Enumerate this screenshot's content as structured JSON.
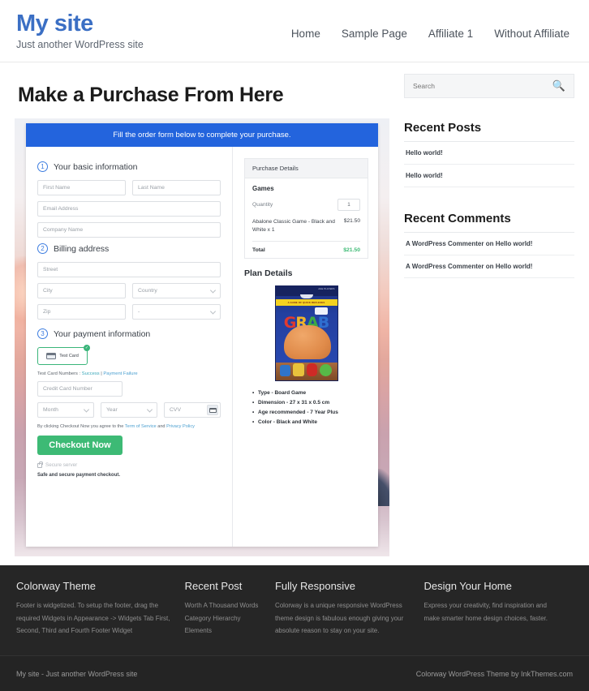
{
  "header": {
    "site_title": "My site",
    "tagline": "Just another WordPress site",
    "nav": [
      {
        "label": "Home"
      },
      {
        "label": "Sample Page"
      },
      {
        "label": "Affiliate 1"
      },
      {
        "label": "Without Affiliate"
      }
    ]
  },
  "main": {
    "page_title": "Make a Purchase From Here",
    "order_form": {
      "banner": "Fill the order form below to complete your purchase.",
      "steps": [
        {
          "number": "1",
          "label": "Your basic information"
        },
        {
          "number": "2",
          "label": "Billing address"
        },
        {
          "number": "3",
          "label": "Your payment information"
        }
      ],
      "fields": {
        "first_name": "First Name",
        "last_name": "Last Name",
        "email": "Email Address",
        "company": "Company Name",
        "street": "Street",
        "city": "City",
        "country": "Country",
        "zip": "Zip",
        "state": "-",
        "credit_card_number": "Credit Card Number",
        "month": "Month",
        "year": "Year",
        "cvv": "CVV"
      },
      "card_option": {
        "label": "Test Card",
        "selected_mark": "✓"
      },
      "test_numbers": {
        "prefix": "Test Card Numbers : ",
        "success": "Success",
        "separator": " | ",
        "failure": "Payment Failure"
      },
      "terms": {
        "prefix": "By clicking Checkout Now you agree to the ",
        "tos": "Term of Service",
        "mid": " and ",
        "privacy": "Privacy Policy"
      },
      "checkout_label": "Checkout Now",
      "secure_server": "Secure server",
      "safe_text": "Safe and secure payment checkout."
    },
    "purchase_details": {
      "heading": "Purchase Details",
      "group": "Games",
      "quantity_label": "Quantity",
      "quantity_value": "1",
      "item_name": "Abalone Classic Game - Black and White x 1",
      "item_price": "$21.50",
      "total_label": "Total",
      "total_value": "$21.50",
      "total_color": "#3dba75"
    },
    "plan_details": {
      "heading": "Plan Details",
      "product_art": {
        "title": "GRAB",
        "banner": "A GAME OF QUICK REFLEXES",
        "corner": "AGE  PLAYERS"
      },
      "specs": [
        "Type - Board Game",
        "Dimension - 27 x 31 x 0.5 cm",
        "Age recommended - 7 Year Plus",
        "Color - Black and White"
      ]
    }
  },
  "sidebar": {
    "search_placeholder": "Search",
    "widgets": [
      {
        "title": "Recent Posts",
        "items": [
          "Hello world!",
          "Hello world!"
        ]
      },
      {
        "title": "Recent Comments",
        "items": [
          "A WordPress Commenter on Hello world!",
          "A WordPress Commenter on Hello world!"
        ]
      }
    ]
  },
  "footer": {
    "columns": [
      {
        "title": "Colorway Theme",
        "text": "Footer is widgetized. To setup the footer, drag the required Widgets in Appearance -> Widgets Tab First, Second, Third and Fourth Footer Widget"
      },
      {
        "title": "Recent Post",
        "items": [
          "Worth A Thousand Words",
          "Category Hierarchy",
          "Elements"
        ]
      },
      {
        "title": "Fully Responsive",
        "text": "Colorway is a unique responsive WordPress theme design is fabulous enough giving your absolute reason to stay on your site."
      },
      {
        "title": "Design Your Home",
        "text": "Express your creativity, find inspiration and make smarter home design choices, faster."
      }
    ],
    "bar_left": "My site - Just another WordPress site",
    "bar_right": "Colorway WordPress Theme by InkThemes.com"
  }
}
